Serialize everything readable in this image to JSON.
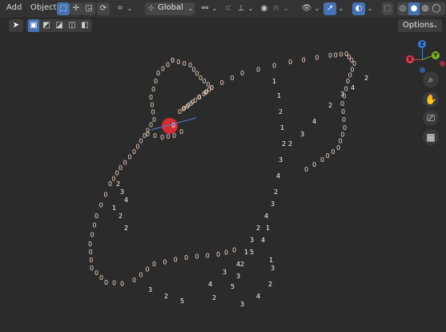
{
  "menu": {
    "add": "Add",
    "object": "Object"
  },
  "header": {
    "transform_orientation": "Global",
    "options_label": "Options"
  },
  "colors": {
    "accent": "#4772b3",
    "selected_point": "#d22c36",
    "point_label": "#f0d7c0",
    "label_white": "#ffffff",
    "gizmo_x": "#e0394d",
    "gizmo_y": "#79b42d",
    "gizmo_z": "#3d7ce0"
  },
  "icons": [
    "cursor-icon",
    "select-box-icon",
    "move-icon",
    "rotate-icon",
    "scale-icon",
    "transform-icon",
    "pivot-icon",
    "snap-icon",
    "proportional-icon",
    "visibility-icon",
    "overlay-icon",
    "xray-icon",
    "shading-icon",
    "zoom-icon",
    "hand-icon",
    "camera-icon",
    "grid-icon"
  ],
  "labels": {
    "outer_zero": "0",
    "series": [
      "1",
      "2",
      "3",
      "4",
      "5"
    ],
    "chain_a": [
      "0",
      "0",
      "0",
      "0",
      "0",
      "0",
      "0",
      "0",
      "0",
      "0",
      "0",
      "0",
      "0",
      "0",
      "0",
      "0",
      "0",
      "0",
      "0",
      "0"
    ],
    "chain_b": [
      "1",
      "2",
      "3",
      "4",
      "5",
      "0",
      "2",
      "3",
      "4",
      "1"
    ]
  },
  "gizmo": {
    "x": "X",
    "y": "Y",
    "z": "Z"
  }
}
